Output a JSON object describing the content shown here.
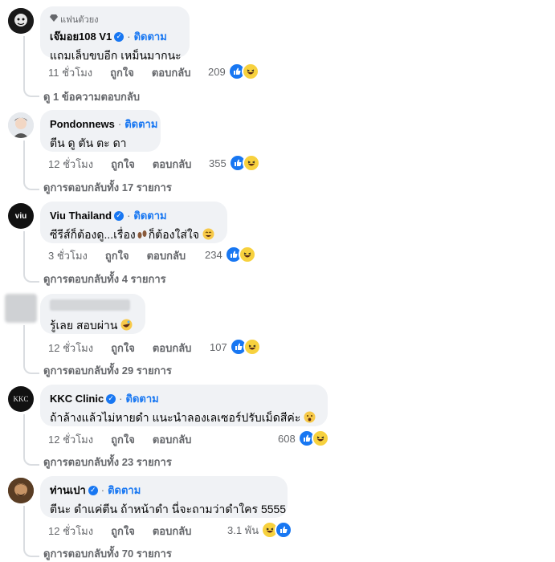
{
  "comments": [
    {
      "badge": "แฟนตัวยง",
      "name": "เจ๊มอย108 V1",
      "follow": "ติดตาม",
      "dot": "·",
      "text": "แถมเล็บขบอีก เหม็นมากนะ",
      "time": "11 ชั่วโมง",
      "like": "ถูกใจ",
      "reply": "ตอบกลับ",
      "reaction_count": "209",
      "view_replies": "ดู 1 ข้อความตอบกลับ"
    },
    {
      "name": "Pondonnews",
      "follow": "ติดตาม",
      "dot": "·",
      "text": "ตีน ดู ตัน ตะ ดา",
      "time": "12 ชั่วโมง",
      "like": "ถูกใจ",
      "reply": "ตอบกลับ",
      "reaction_count": "355",
      "view_replies": "ดูการตอบกลับทั้ง 17 รายการ"
    },
    {
      "name": "Viu Thailand",
      "follow": "ติดตาม",
      "dot": "·",
      "text_before": "ซีรีส์ก็ต้องดู...เรื่อง",
      "text_after": "ก็ต้องใส่ใจ",
      "avatar_text": "viu",
      "time": "3 ชั่วโมง",
      "like": "ถูกใจ",
      "reply": "ตอบกลับ",
      "reaction_count": "234",
      "view_replies": "ดูการตอบกลับทั้ง 4 รายการ"
    },
    {
      "text": "รู้เลย สอบผ่าน",
      "time": "12 ชั่วโมง",
      "like": "ถูกใจ",
      "reply": "ตอบกลับ",
      "reaction_count": "107",
      "view_replies": "ดูการตอบกลับทั้ง 29 รายการ"
    },
    {
      "name": "KKC Clinic",
      "follow": "ติดตาม",
      "dot": "·",
      "text": "ถ้าล้างแล้วไม่หายดำ แนะนำลองเลเซอร์ปรับเม็ดสีค่ะ",
      "avatar_text": "KKC",
      "time": "12 ชั่วโมง",
      "like": "ถูกใจ",
      "reply": "ตอบกลับ",
      "reaction_count": "608",
      "view_replies": "ดูการตอบกลับทั้ง 23 รายการ"
    },
    {
      "name": "ท่านเปา",
      "follow": "ติดตาม",
      "dot": "·",
      "text": "ตีนะ ดำแค่ตีน ถ้าหน้าดำ นี่จะถามว่าดำใคร 5555",
      "time": "12 ชั่วโมง",
      "like": "ถูกใจ",
      "reply": "ตอบกลับ",
      "reaction_count": "3.1 พัน",
      "view_replies": "ดูการตอบกลับทั้ง 70 รายการ"
    }
  ],
  "colors": {
    "accent": "#1877f2",
    "bubble": "#f0f2f5",
    "meta": "#65676b"
  },
  "icons": [
    "diamond-icon",
    "verified-badge-icon",
    "like-reaction-icon",
    "haha-reaction-icon",
    "laughing-emoji-icon",
    "footprints-emoji-icon",
    "rolling-laugh-emoji-icon",
    "surprised-emoji-icon"
  ]
}
